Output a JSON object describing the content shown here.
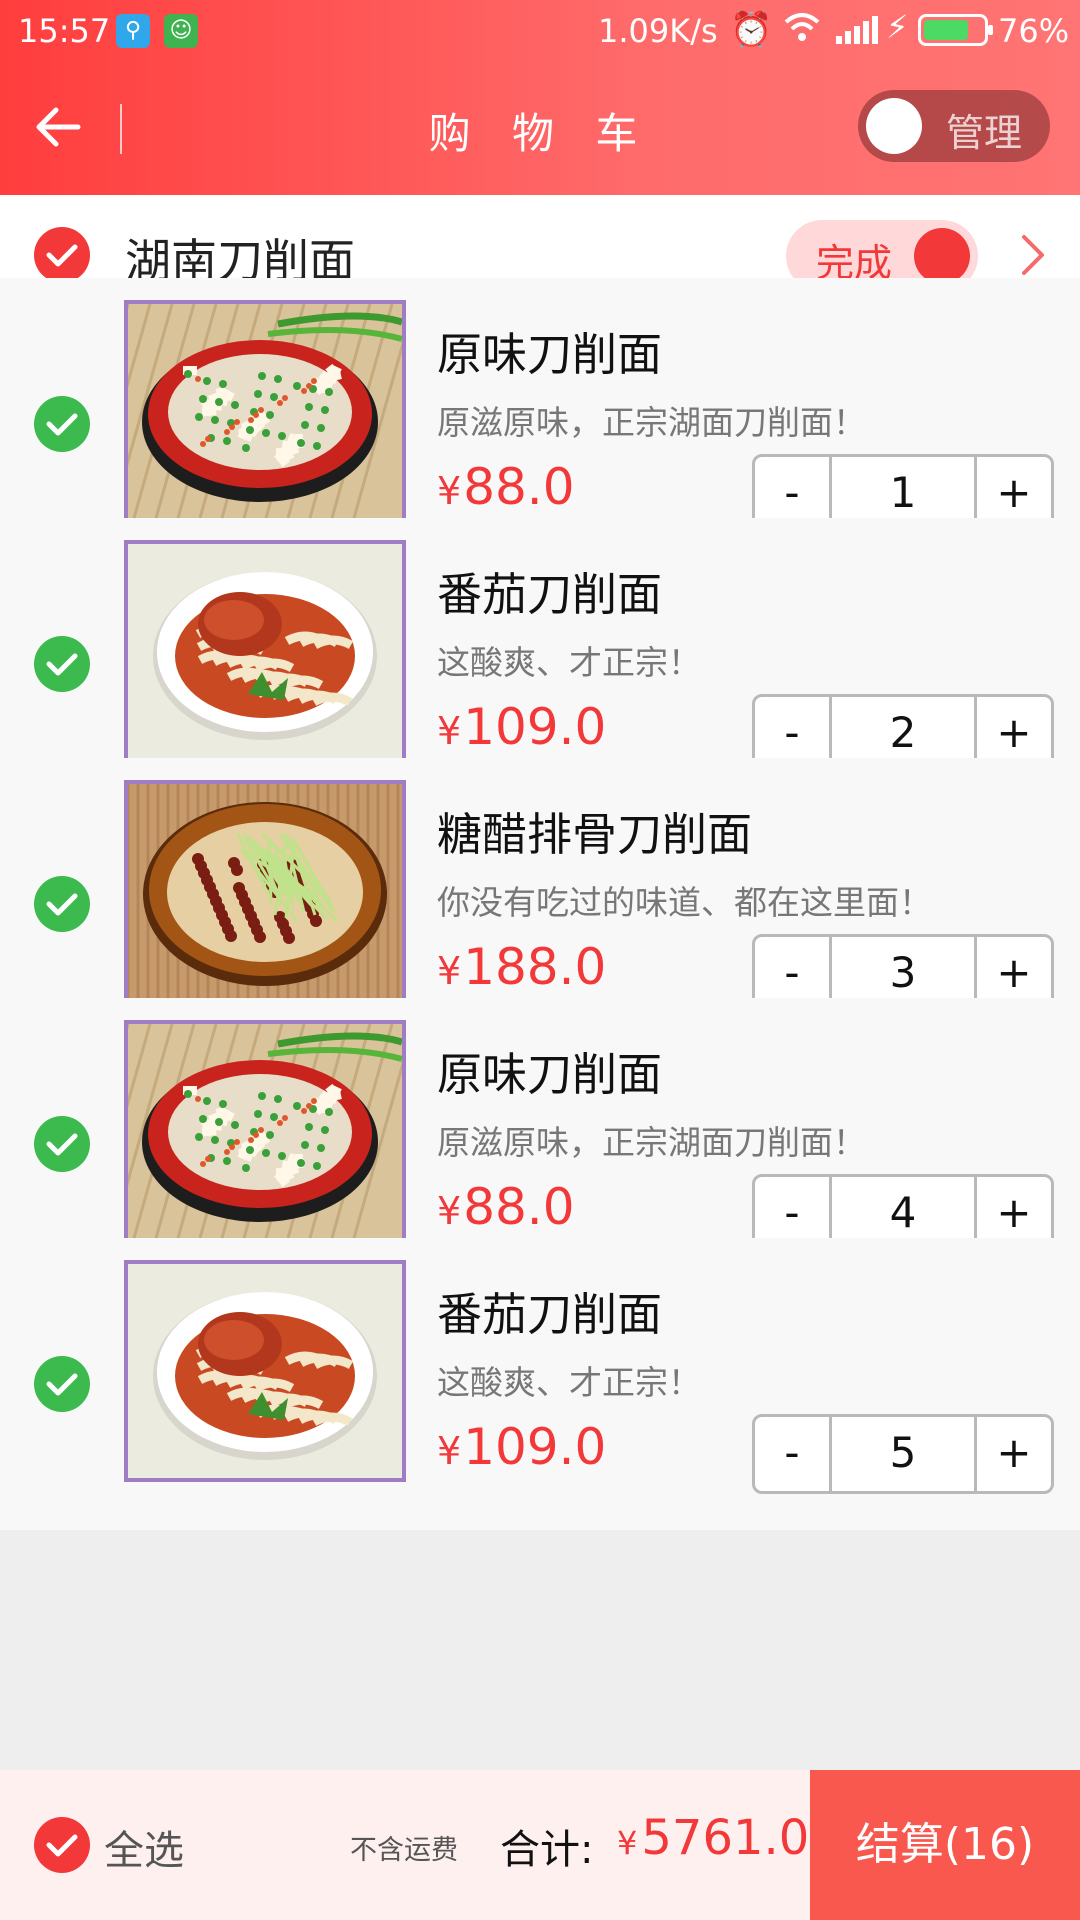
{
  "status_bar": {
    "time": "15:57",
    "net_speed": "1.09K/s",
    "battery_percent": "76%",
    "battery_level": 0.76
  },
  "app_bar": {
    "title": "购 物 车",
    "manage_label": "管理"
  },
  "store": {
    "name": "湖南刀削面",
    "done_label": "完成"
  },
  "items": [
    {
      "name": "原味刀削面",
      "desc": "原滋原味，正宗湖面刀削面！",
      "currency": "¥",
      "price": "88.0",
      "qty": "1",
      "image": "red-bowl-noodles"
    },
    {
      "name": "番茄刀削面",
      "desc": "这酸爽、才正宗！",
      "currency": "¥",
      "price": "109.0",
      "qty": "2",
      "image": "white-bowl-tomato-noodles"
    },
    {
      "name": "糖醋排骨刀削面",
      "desc": "你没有吃过的味道、都在这里面！",
      "currency": "¥",
      "price": "188.0",
      "qty": "3",
      "image": "brown-bowl-rib-noodles"
    },
    {
      "name": "原味刀削面",
      "desc": "原滋原味，正宗湖面刀削面！",
      "currency": "¥",
      "price": "88.0",
      "qty": "4",
      "image": "red-bowl-noodles"
    },
    {
      "name": "番茄刀削面",
      "desc": "这酸爽、才正宗！",
      "currency": "¥",
      "price": "109.0",
      "qty": "5",
      "image": "white-bowl-tomato-noodles"
    }
  ],
  "stepper": {
    "minus": "-",
    "plus": "+"
  },
  "bottom_bar": {
    "select_all": "全选",
    "freight_note": "不含运费",
    "total_label": "合计:",
    "currency": "¥",
    "total_value": "5761.0",
    "checkout_label": "结算(16)"
  },
  "colors": {
    "accent_red": "#f23838",
    "check_green": "#3cba4d",
    "thumb_border": "#a07cc5",
    "checkout_bg": "#f8584e"
  },
  "icons": {
    "back": "arrow-left-icon",
    "check": "checkmark-icon",
    "chevron": "chevron-right-icon"
  }
}
